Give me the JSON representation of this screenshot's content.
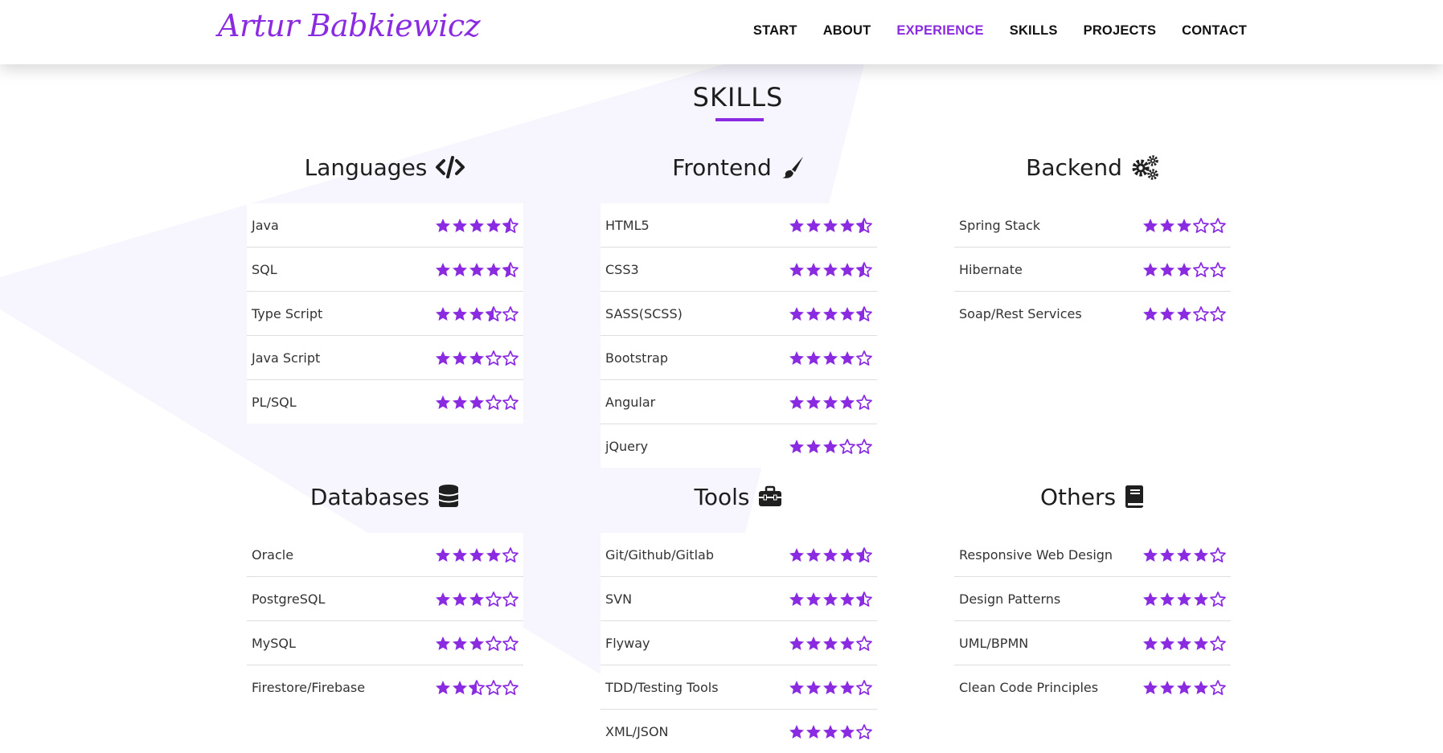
{
  "brand": "Artur Babkiewicz",
  "accent": "#8a2be2",
  "nav": [
    {
      "label": "START",
      "active": false
    },
    {
      "label": "ABOUT",
      "active": false
    },
    {
      "label": "EXPERIENCE",
      "active": true
    },
    {
      "label": "SKILLS",
      "active": false
    },
    {
      "label": "PROJECTS",
      "active": false
    },
    {
      "label": "CONTACT",
      "active": false
    }
  ],
  "section_title": "SKILLS",
  "star_max": 5,
  "groups": [
    {
      "title": "Languages",
      "icon": "code-icon",
      "skills": [
        {
          "name": "Java",
          "rating": 4.5
        },
        {
          "name": "SQL",
          "rating": 4.5
        },
        {
          "name": "Type Script",
          "rating": 3.5
        },
        {
          "name": "Java Script",
          "rating": 3
        },
        {
          "name": "PL/SQL",
          "rating": 3
        }
      ]
    },
    {
      "title": "Frontend",
      "icon": "paint-brush-icon",
      "skills": [
        {
          "name": "HTML5",
          "rating": 4.5
        },
        {
          "name": "CSS3",
          "rating": 4.5
        },
        {
          "name": "SASS(SCSS)",
          "rating": 4.5
        },
        {
          "name": "Bootstrap",
          "rating": 4
        },
        {
          "name": "Angular",
          "rating": 4
        },
        {
          "name": "jQuery",
          "rating": 3
        }
      ]
    },
    {
      "title": "Backend",
      "icon": "cogs-icon",
      "skills": [
        {
          "name": "Spring Stack",
          "rating": 3
        },
        {
          "name": "Hibernate",
          "rating": 3
        },
        {
          "name": "Soap/Rest Services",
          "rating": 3
        }
      ]
    },
    {
      "title": "Databases",
      "icon": "database-icon",
      "skills": [
        {
          "name": "Oracle",
          "rating": 4
        },
        {
          "name": "PostgreSQL",
          "rating": 3
        },
        {
          "name": "MySQL",
          "rating": 3
        },
        {
          "name": "Firestore/Firebase",
          "rating": 2.5
        }
      ]
    },
    {
      "title": "Tools",
      "icon": "toolbox-icon",
      "skills": [
        {
          "name": "Git/Github/Gitlab",
          "rating": 4.5
        },
        {
          "name": "SVN",
          "rating": 4.5
        },
        {
          "name": "Flyway",
          "rating": 4
        },
        {
          "name": "TDD/Testing Tools",
          "rating": 4
        },
        {
          "name": "XML/JSON",
          "rating": 4
        }
      ]
    },
    {
      "title": "Others",
      "icon": "book-icon",
      "skills": [
        {
          "name": "Responsive Web Design",
          "rating": 4
        },
        {
          "name": "Design Patterns",
          "rating": 4
        },
        {
          "name": "UML/BPMN",
          "rating": 4
        },
        {
          "name": "Clean Code Principles",
          "rating": 4
        }
      ]
    }
  ]
}
